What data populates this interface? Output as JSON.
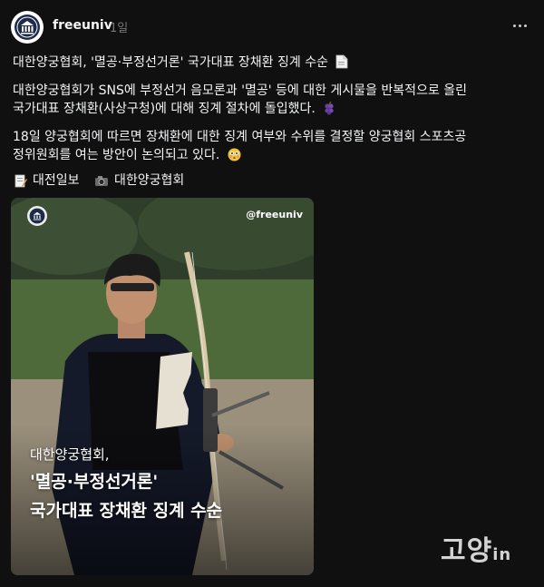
{
  "header": {
    "username": "freeuniv",
    "timestamp": "1일",
    "avatar_icon": "university-seal-icon"
  },
  "post": {
    "title": "대한양궁협회, '멸공·부정선거론' 국가대표 장채환 징계 수순",
    "title_emoji": "page-icon",
    "body_line1": "대한양궁협회가 SNS에 부정선거 음모론과 '멸공' 등에 대한 게시물을 반복적으로 올린",
    "body_line2": "국가대표 장채환(사상구청)에 대해 징계 절차에 돌입했다.",
    "body_line2_emoji": "grapes-icon",
    "body_line3": "18일 양궁협회에 따르면 장채환에 대한 징계 여부와 수위를 결정할 양궁협회 스포츠공",
    "body_line4": "정위원회를 여는 방안이 논의되고 있다.",
    "body_line4_emoji": "flushed-face-icon"
  },
  "sources": [
    {
      "icon": "memo-icon",
      "label": "대전일보"
    },
    {
      "icon": "camera-icon",
      "label": "대한양궁협회"
    }
  ],
  "image": {
    "handle": "@freeuniv",
    "caption_line1": "대한양궁협회,",
    "caption_line2": "'멸공·부정선거론'",
    "caption_line3": "국가대표 장채환 징계 수순"
  },
  "watermark": {
    "text": "고양",
    "suffix": "in"
  },
  "colors": {
    "background": "#101010",
    "text": "#f3f5f7",
    "muted": "#777777"
  }
}
